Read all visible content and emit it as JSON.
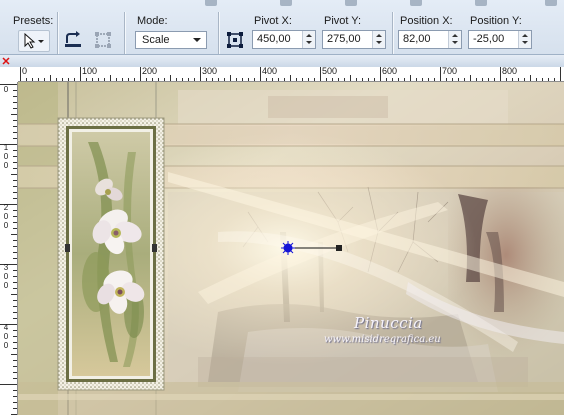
{
  "tool_options": {
    "presets_label": "Presets:",
    "mode_label": "Mode:",
    "mode_value": "Scale",
    "pivot_x_label": "Pivot X:",
    "pivot_x_value": "450,00",
    "pivot_y_label": "Pivot Y:",
    "pivot_y_value": "275,00",
    "position_x_label": "Position X:",
    "position_x_value": "82,00",
    "position_y_label": "Position Y:",
    "position_y_value": "-25,00"
  },
  "rulers": {
    "horizontal_labels": [
      "0",
      "100",
      "200",
      "300",
      "400",
      "500",
      "600",
      "700",
      "800"
    ],
    "vertical_labels": [
      [
        "0"
      ],
      [
        "1",
        "0",
        "0"
      ],
      [
        "2",
        "0",
        "0"
      ],
      [
        "3",
        "0",
        "0"
      ],
      [
        "4",
        "0",
        "0"
      ]
    ]
  },
  "canvas": {
    "watermark_name": "Pinuccia",
    "watermark_url": "www.misidreqrafica.eu"
  },
  "colors": {
    "toolbar_bg": "#dbe5f0",
    "pivot_handle": "#1414d6",
    "canvas_base": "#cdc6ab"
  }
}
